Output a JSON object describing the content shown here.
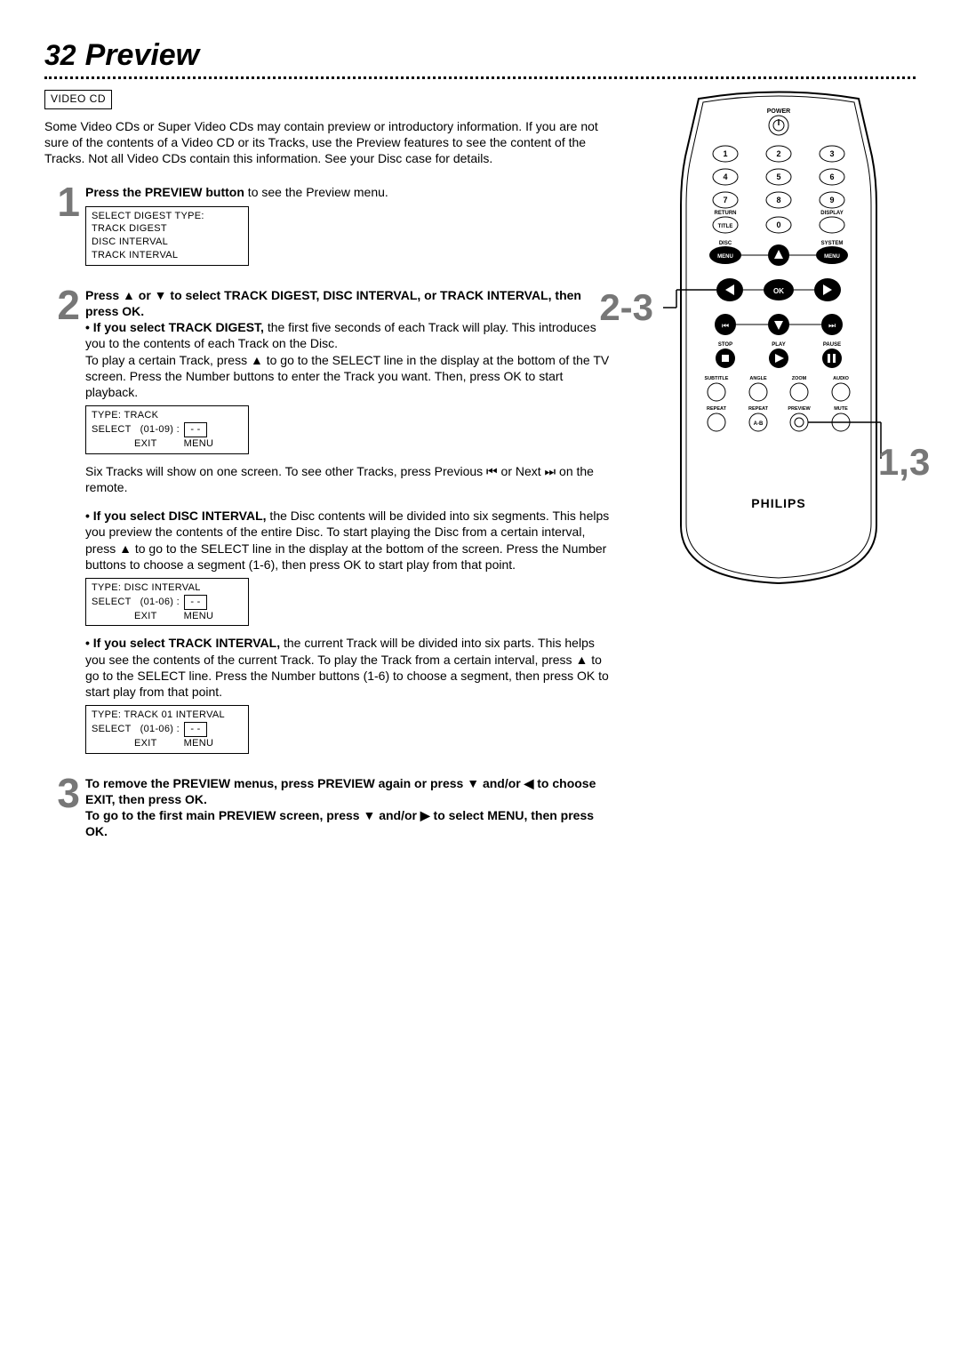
{
  "page_number": "32",
  "title": "Preview",
  "tag": "VIDEO CD",
  "intro": "Some Video CDs or Super Video CDs may contain preview or introductory information. If you are not sure of the contents of a Video CD or its Tracks, use the Preview features to see the content of the Tracks. Not all Video CDs contain this information. See your Disc case for details.",
  "steps": {
    "s1": {
      "num": "1",
      "lead_bold": "Press the PREVIEW button",
      "lead_rest": " to see the Preview menu.",
      "osd": {
        "l1": "SELECT DIGEST TYPE:",
        "l2": "TRACK DIGEST",
        "l3": "DISC INTERVAL",
        "l4": "TRACK INTERVAL"
      }
    },
    "s2": {
      "num": "2",
      "heading": "Press ▲ or ▼ to select TRACK DIGEST, DISC INTERVAL, or TRACK INTERVAL, then press OK.",
      "td_bold": "• If you select TRACK DIGEST,",
      "td_rest": " the first five seconds of each Track will play. This introduces you to the contents of each Track on the Disc.",
      "td_para2": "To play a certain Track, press ▲ to go to the SELECT line in the display at the bottom of the TV screen. Press the Number buttons to enter the Track you want. Then, press OK to start playback.",
      "osd_track": {
        "l1": "TYPE:  TRACK",
        "sel_label": "SELECT",
        "sel_range": "(01-09) :",
        "dash": "- -",
        "f1": "EXIT",
        "f2": "MENU"
      },
      "six_tracks": "Six Tracks will show on one screen. To see other Tracks, press Previous ⏮ or Next ⏭ on the remote.",
      "di_bold": "• If you select DISC INTERVAL,",
      "di_rest": " the Disc contents will be divided into six segments. This helps you preview the contents of the entire Disc.  To start playing the Disc from a certain interval, press ▲ to go to the SELECT line in the display at the bottom of the screen. Press the Number buttons to choose a segment (1-6), then press OK to start play from that point.",
      "osd_disc": {
        "l1": "TYPE:  DISC INTERVAL",
        "sel_label": "SELECT",
        "sel_range": "(01-06) :",
        "dash": "- -",
        "f1": "EXIT",
        "f2": "MENU"
      },
      "ti_bold": "• If you select TRACK INTERVAL,",
      "ti_rest": " the current Track will be divided into six parts. This helps you see the contents of the current Track. To play the Track from a certain interval, press ▲ to go to the SELECT line. Press the Number buttons (1-6) to choose a segment, then press OK to start play from that point.",
      "osd_tint": {
        "l1": "TYPE:  TRACK 01 INTERVAL",
        "sel_label": "SELECT",
        "sel_range": "(01-06) :",
        "dash": "- -",
        "f1": "EXIT",
        "f2": "MENU"
      }
    },
    "s3": {
      "num": "3",
      "line1": "To remove the PREVIEW menus, press PREVIEW again or press ▼ and/or ◀ to choose EXIT, then press OK.",
      "line2": "To go to the first main PREVIEW screen, press ▼ and/or ▶ to select MENU, then press OK."
    }
  },
  "callouts": {
    "left": "2-3",
    "right": "1,3"
  },
  "remote": {
    "brand": "PHILIPS",
    "labels": {
      "power": "POWER",
      "return": "RETURN",
      "display": "DISPLAY",
      "title": "TITLE",
      "disc": "DISC",
      "system": "SYSTEM",
      "menu": "MENU",
      "ok": "OK",
      "stop": "STOP",
      "play": "PLAY",
      "pause": "PAUSE",
      "subtitle": "SUBTITLE",
      "angle": "ANGLE",
      "zoom": "ZOOM",
      "audio": "AUDIO",
      "repeat": "REPEAT",
      "repeat_ab": "REPEAT",
      "ab": "A-B",
      "preview": "PREVIEW",
      "mute": "MUTE"
    },
    "numbers": [
      "1",
      "2",
      "3",
      "4",
      "5",
      "6",
      "7",
      "8",
      "9",
      "0"
    ]
  }
}
